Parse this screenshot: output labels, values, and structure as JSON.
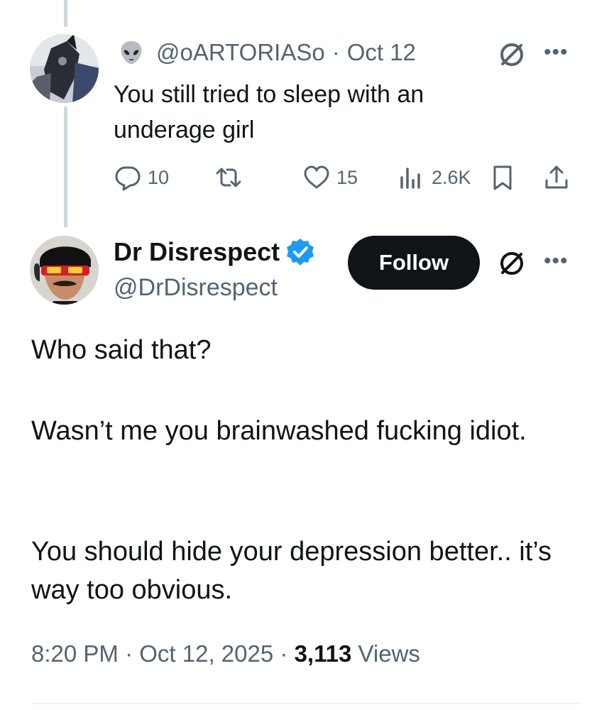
{
  "reply": {
    "handle": "@oARTORIASo",
    "separator": "·",
    "date": "Oct 12",
    "text": "You still tried to sleep with an underage girl",
    "stats": {
      "replies": "10",
      "likes": "15",
      "views": "2.6K"
    }
  },
  "main_tweet": {
    "display_name": "Dr Disrespect",
    "handle": "@DrDisrespect",
    "follow_label": "Follow",
    "paragraphs": [
      "Who said that?",
      "Wasn’t me you brainwashed fucking idiot.",
      "You should hide your depression better.. it’s way too obvious."
    ],
    "time": "8:20 PM",
    "date": "Oct 12, 2025",
    "separator": "·",
    "views_count": "3,113",
    "views_label": "Views"
  },
  "icons": {
    "alien": "alien-emoji-icon",
    "grok": "grok-icon",
    "more": "more-icon",
    "reply": "reply-icon",
    "repost": "repost-icon",
    "like": "like-icon",
    "views": "views-icon",
    "bookmark": "bookmark-icon",
    "share": "share-icon",
    "verified": "verified-badge-icon"
  },
  "colors": {
    "text": "#0f1419",
    "secondary": "#536471",
    "verified": "#1d9bf0",
    "follow_bg": "#0f1419",
    "thread_line": "#cfd9de"
  }
}
